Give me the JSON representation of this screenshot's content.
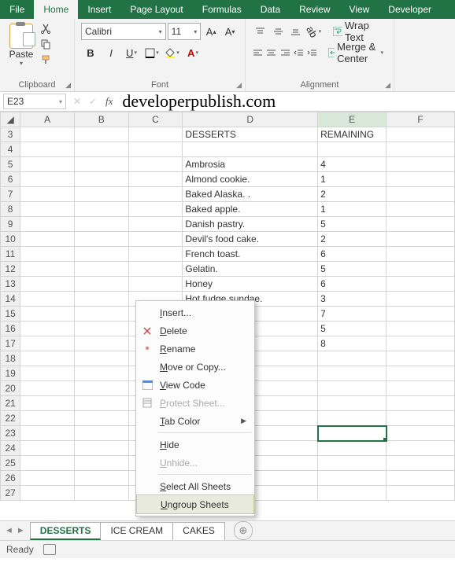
{
  "tabs": {
    "file": "File",
    "home": "Home",
    "insert": "Insert",
    "pagelayout": "Page Layout",
    "formulas": "Formulas",
    "data": "Data",
    "review": "Review",
    "view": "View",
    "developer": "Developer"
  },
  "ribbon": {
    "clipboard_label": "Clipboard",
    "paste_label": "Paste",
    "font_label": "Font",
    "font_name": "Calibri",
    "font_size": "11",
    "align_label": "Alignment",
    "wrap_text": "Wrap Text",
    "merge_center": "Merge & Center"
  },
  "namebox": "E23",
  "watermark": "developerpublish.com",
  "columns": [
    "A",
    "B",
    "C",
    "D",
    "E",
    "F"
  ],
  "row_start": 3,
  "row_end": 27,
  "headers": {
    "d": "DESSERTS",
    "e": "REMAINING"
  },
  "rows": [
    {
      "r": 5,
      "d": "Ambrosia",
      "e": 4
    },
    {
      "r": 6,
      "d": "Almond cookie.",
      "e": 1
    },
    {
      "r": 7,
      "d": "Baked Alaska. .",
      "e": 2
    },
    {
      "r": 8,
      "d": "Baked apple.",
      "e": 1
    },
    {
      "r": 9,
      "d": "Danish pastry.",
      "e": 5
    },
    {
      "r": 10,
      "d": "Devil's food cake.",
      "e": 2
    },
    {
      "r": 11,
      "d": "French toast.",
      "e": 6
    },
    {
      "r": 12,
      "d": "Gelatin.",
      "e": 5
    },
    {
      "r": 13,
      "d": "Honey",
      "e": 6
    },
    {
      "r": 14,
      "d": "Hot fudge sundae.",
      "e": 3
    },
    {
      "r": 15,
      "d": "",
      "e": 7
    },
    {
      "r": 16,
      "d": "",
      "e": 5
    },
    {
      "r": 17,
      "d": "",
      "e": 8
    }
  ],
  "context_menu": [
    {
      "label": "Insert...",
      "key": "I",
      "icon": ""
    },
    {
      "label": "Delete",
      "key": "D",
      "icon": "x"
    },
    {
      "label": "Rename",
      "key": "R",
      "icon": "dot"
    },
    {
      "label": "Move or Copy...",
      "key": "M",
      "icon": ""
    },
    {
      "label": "View Code",
      "key": "V",
      "icon": "code"
    },
    {
      "label": "Protect Sheet...",
      "key": "P",
      "icon": "sheet",
      "disabled": true
    },
    {
      "label": "Tab Color",
      "key": "T",
      "icon": "",
      "submenu": true
    },
    {
      "sep": true
    },
    {
      "label": "Hide",
      "key": "H",
      "icon": ""
    },
    {
      "label": "Unhide...",
      "key": "U",
      "icon": "",
      "disabled": true
    },
    {
      "sep": true
    },
    {
      "label": "Select All Sheets",
      "key": "S",
      "icon": ""
    },
    {
      "label": "Ungroup Sheets",
      "key": "U",
      "icon": "",
      "highlighted": true
    }
  ],
  "sheets": [
    {
      "name": "DESSERTS",
      "active": true
    },
    {
      "name": "ICE CREAM",
      "grouped": true
    },
    {
      "name": "CAKES",
      "grouped": true
    }
  ],
  "status": "Ready"
}
